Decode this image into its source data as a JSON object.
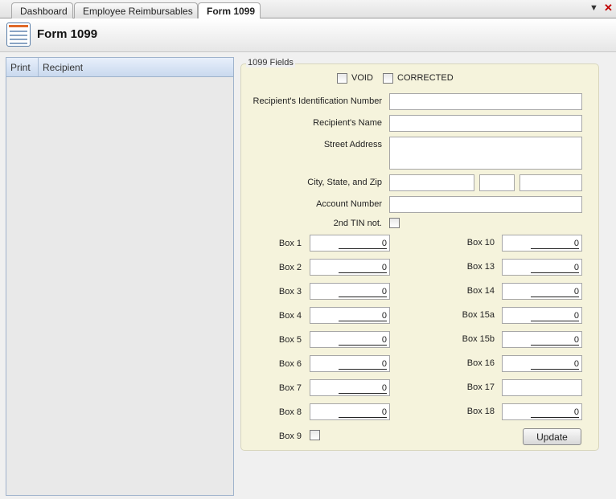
{
  "tabs": [
    {
      "label": "Dashboard"
    },
    {
      "label": "Employee Reimbursables"
    },
    {
      "label": "Form 1099",
      "active": true
    }
  ],
  "header": {
    "title": "Form 1099"
  },
  "list": {
    "columns": [
      "Print",
      "Recipient"
    ],
    "rows": []
  },
  "form": {
    "legend": "1099 Fields",
    "void_label": "VOID",
    "corrected_label": "CORRECTED",
    "recipient_id_label": "Recipient's Identification Number",
    "recipient_id_value": "",
    "recipient_name_label": "Recipient's Name",
    "recipient_name_value": "",
    "street_label": "Street Address",
    "street_value": "",
    "city_label": "City, State, and Zip",
    "city_value": "",
    "state_value": "",
    "zip_value": "",
    "account_label": "Account Number",
    "account_value": "",
    "tin_label": "2nd TIN not.",
    "left_boxes": [
      {
        "label": "Box 1",
        "value": "0"
      },
      {
        "label": "Box 2",
        "value": "0"
      },
      {
        "label": "Box 3",
        "value": "0"
      },
      {
        "label": "Box 4",
        "value": "0"
      },
      {
        "label": "Box 5",
        "value": "0"
      },
      {
        "label": "Box 6",
        "value": "0"
      },
      {
        "label": "Box 7",
        "value": "0"
      },
      {
        "label": "Box 8",
        "value": "0"
      }
    ],
    "box9_label": "Box 9",
    "right_boxes": [
      {
        "label": "Box 10",
        "value": "0"
      },
      {
        "label": "Box 13",
        "value": "0"
      },
      {
        "label": "Box 14",
        "value": "0"
      },
      {
        "label": "Box 15a",
        "value": "0"
      },
      {
        "label": "Box 15b",
        "value": "0"
      },
      {
        "label": "Box 16",
        "value": "0"
      },
      {
        "label": "Box 17",
        "value": ""
      },
      {
        "label": "Box 18",
        "value": "0"
      }
    ],
    "update_label": "Update"
  },
  "icons": {
    "menu": "chevron-down-icon",
    "close": "close-icon",
    "form": "form-icon"
  }
}
